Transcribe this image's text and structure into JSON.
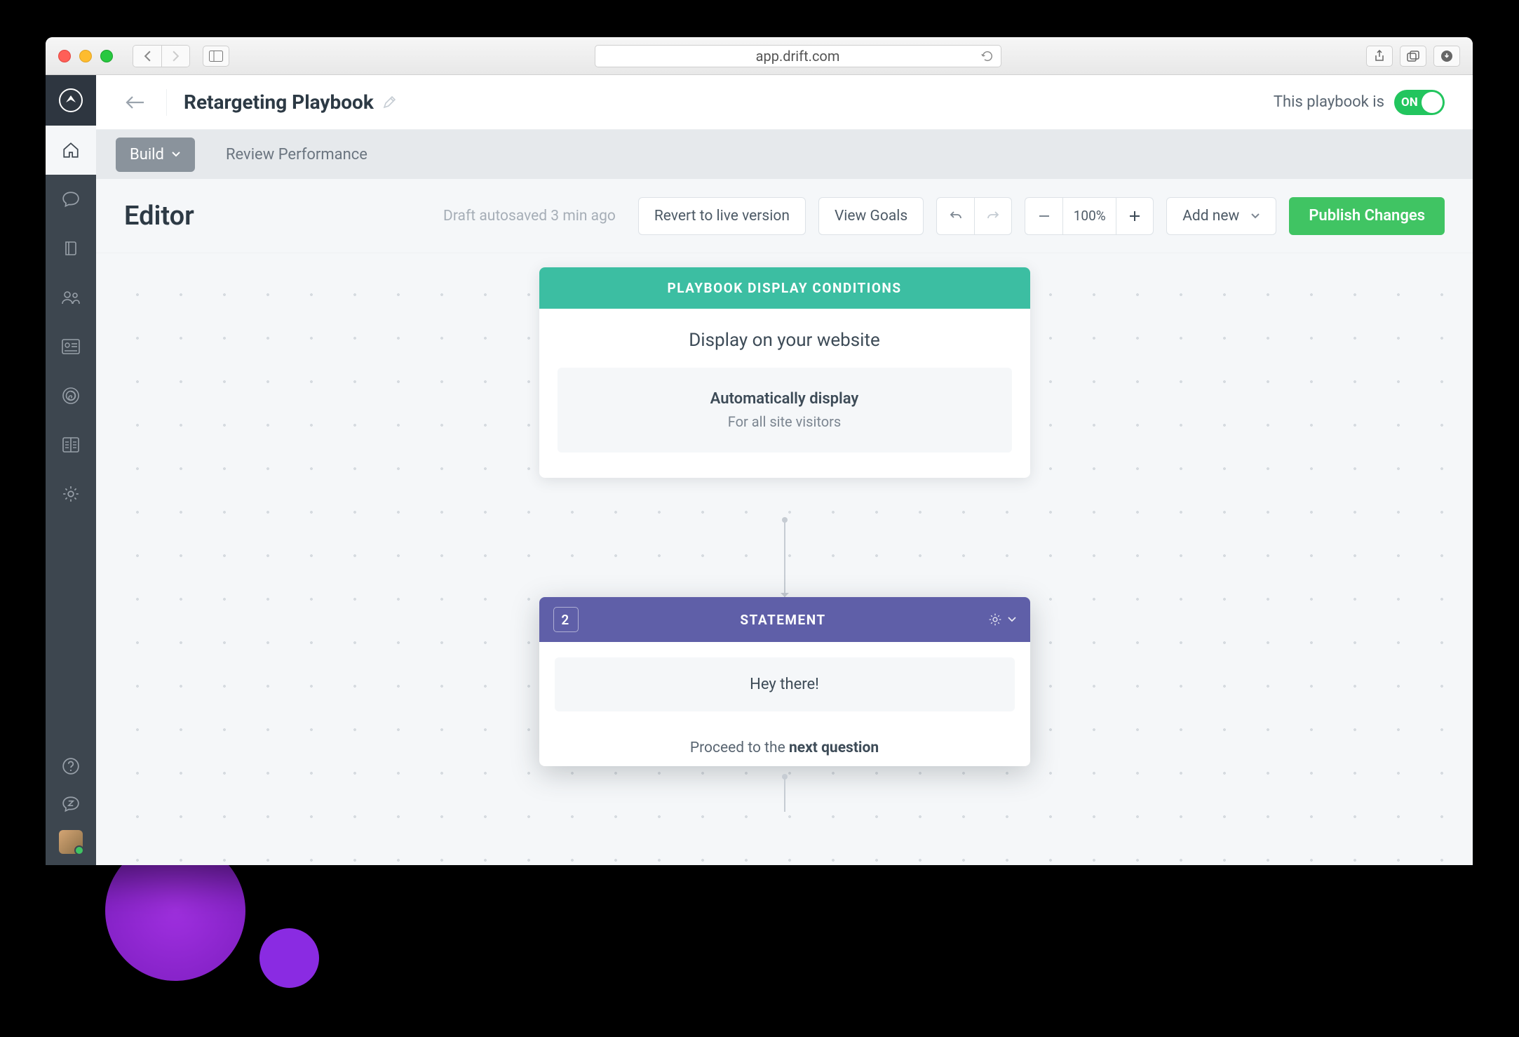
{
  "browser": {
    "url": "app.drift.com"
  },
  "header": {
    "title": "Retargeting Playbook",
    "status_label": "This playbook is",
    "toggle_state": "ON"
  },
  "tabs": {
    "build": "Build",
    "review": "Review Performance"
  },
  "toolbar": {
    "title": "Editor",
    "autosave": "Draft autosaved 3 min ago",
    "revert": "Revert to live version",
    "view_goals": "View Goals",
    "zoom": "100%",
    "add_new": "Add new",
    "publish": "Publish Changes"
  },
  "nodes": {
    "conditions": {
      "header": "PLAYBOOK DISPLAY CONDITIONS",
      "subtitle": "Display on your website",
      "rule_title": "Automatically display",
      "rule_sub": "For all site visitors"
    },
    "statement": {
      "step": "2",
      "header": "STATEMENT",
      "message": "Hey there!",
      "proceed_prefix": "Proceed to the ",
      "proceed_bold": "next question"
    }
  }
}
